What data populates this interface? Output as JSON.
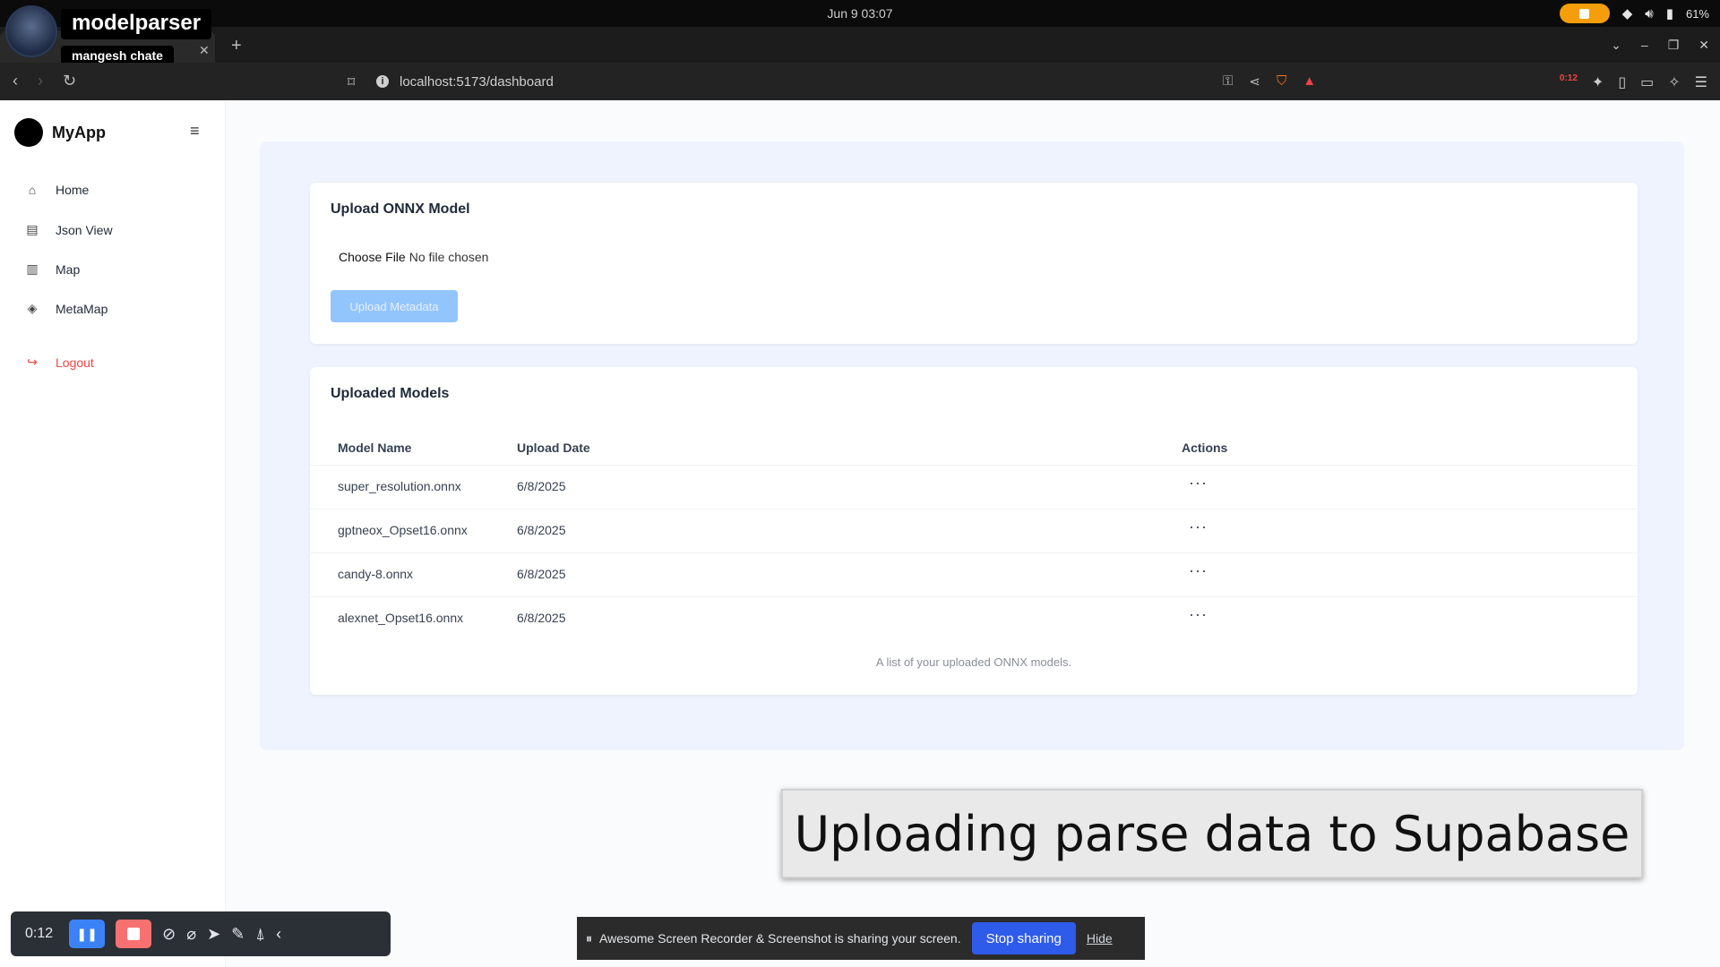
{
  "os": {
    "clock": "Jun 9  03:07",
    "battery": "61%"
  },
  "overlay": {
    "channel": "modelparser",
    "user": "mangesh chate"
  },
  "browser": {
    "url": "localhost:5173/dashboard",
    "ext_badge": "0:12"
  },
  "sidebar": {
    "brand": "MyApp",
    "items": [
      {
        "label": "Home",
        "icon": "home-icon"
      },
      {
        "label": "Json View",
        "icon": "file-icon"
      },
      {
        "label": "Map",
        "icon": "map-icon"
      },
      {
        "label": "MetaMap",
        "icon": "layers-icon"
      }
    ],
    "logout": "Logout"
  },
  "upload": {
    "title": "Upload ONNX Model",
    "choose_file": "Choose File",
    "file_status": "No file chosen",
    "button": "Upload Metadata"
  },
  "models": {
    "title": "Uploaded Models",
    "columns": [
      "Model Name",
      "Upload Date",
      "Actions"
    ],
    "rows": [
      {
        "name": "super_resolution.onnx",
        "date": "6/8/2025",
        "actions": "···"
      },
      {
        "name": "gptneox_Opset16.onnx",
        "date": "6/8/2025",
        "actions": "···"
      },
      {
        "name": "candy-8.onnx",
        "date": "6/8/2025",
        "actions": "···"
      },
      {
        "name": "alexnet_Opset16.onnx",
        "date": "6/8/2025",
        "actions": "···"
      }
    ],
    "caption": "A list of your uploaded ONNX models."
  },
  "subtitle": "Uploading parse data to Supabase",
  "recorder": {
    "time": "0:12"
  },
  "share_bar": {
    "message": "Awesome Screen Recorder & Screenshot is sharing your screen.",
    "stop": "Stop sharing",
    "hide": "Hide"
  },
  "colors": {
    "accent": "#3b82f6",
    "logout": "#ef4444",
    "panel": "#eef3fd"
  }
}
